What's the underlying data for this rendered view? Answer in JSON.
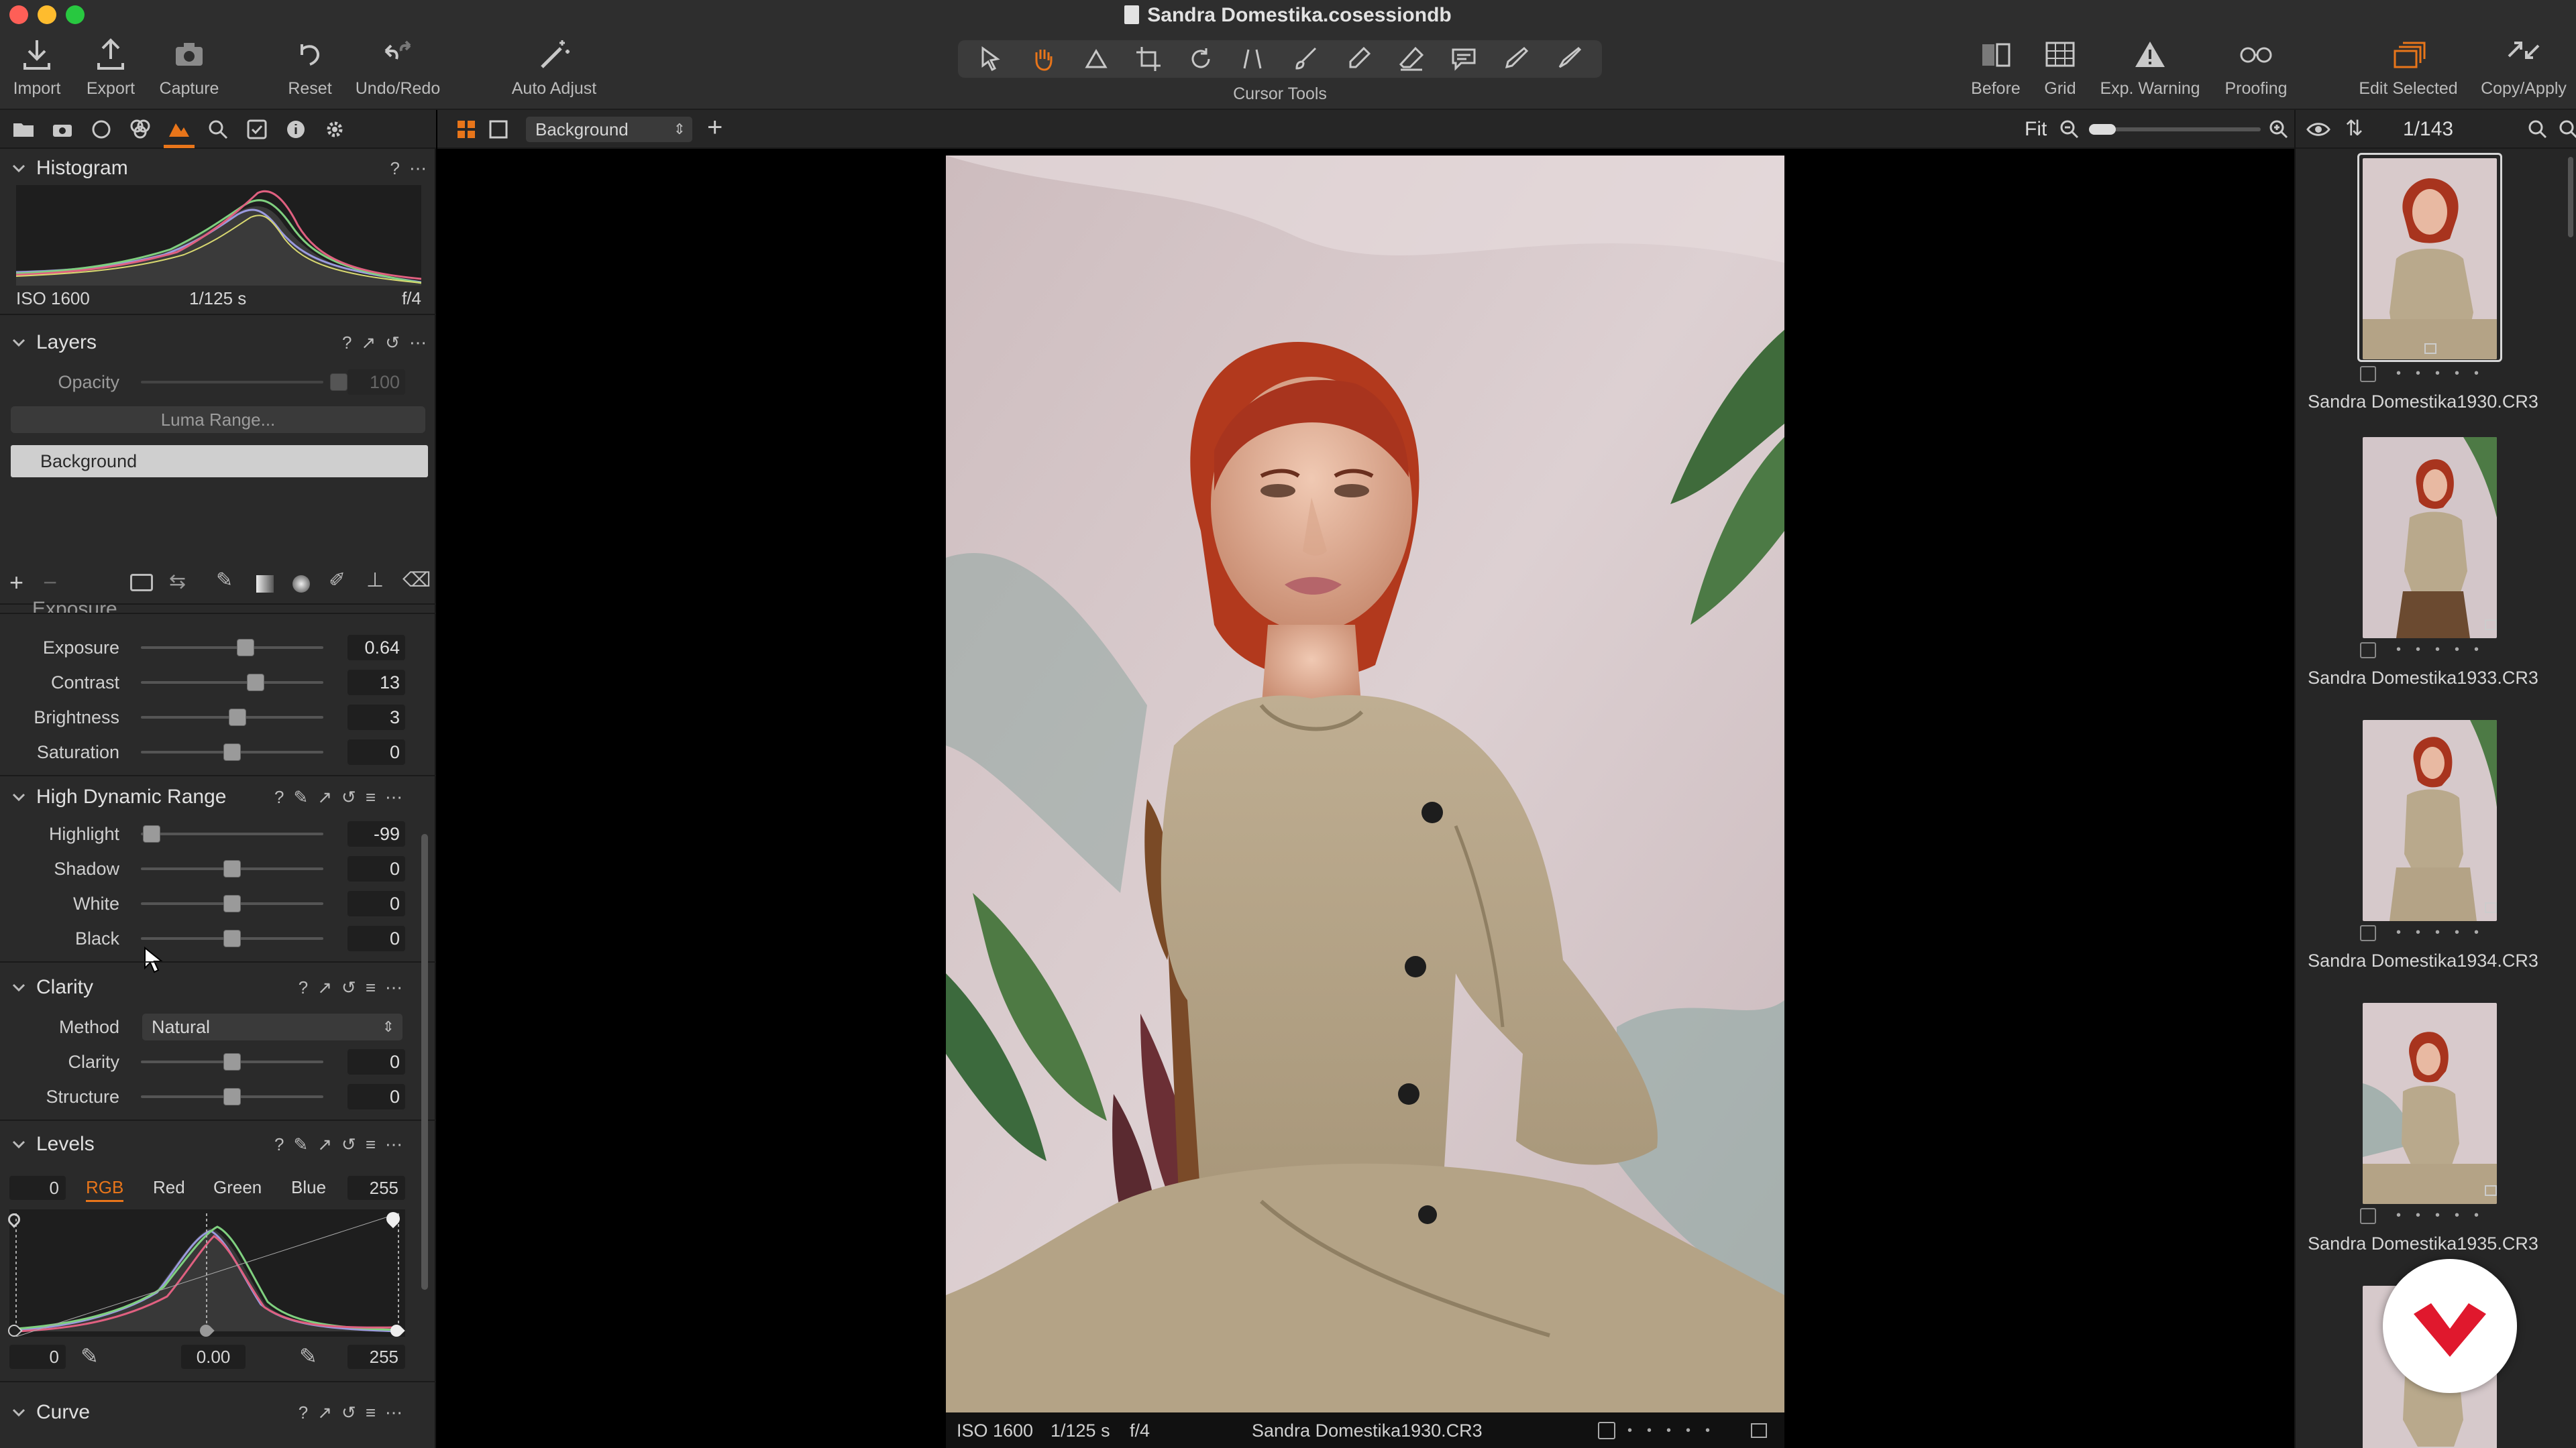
{
  "window": {
    "title": "Sandra Domestika.cosessiondb"
  },
  "toolbar": {
    "left": [
      {
        "label": "Import",
        "icon": "import-icon"
      },
      {
        "label": "Export",
        "icon": "export-icon"
      },
      {
        "label": "Capture",
        "icon": "camera-icon"
      },
      {
        "label": "Reset",
        "icon": "reset-icon"
      },
      {
        "label": "Undo/Redo",
        "icon": "undo-redo-icon"
      },
      {
        "label": "Auto Adjust",
        "icon": "magic-wand-icon"
      }
    ],
    "cursor_tools_label": "Cursor Tools",
    "right": [
      {
        "label": "Before",
        "icon": "before-after-icon"
      },
      {
        "label": "Grid",
        "icon": "grid-icon"
      },
      {
        "label": "Exp. Warning",
        "icon": "warning-icon"
      },
      {
        "label": "Proofing",
        "icon": "glasses-icon"
      },
      {
        "label": "Edit Selected",
        "icon": "edit-selected-icon"
      },
      {
        "label": "Copy/Apply",
        "icon": "copy-apply-icon"
      }
    ]
  },
  "histogram": {
    "title": "Histogram",
    "iso": "ISO 1600",
    "shutter": "1/125 s",
    "aperture": "f/4"
  },
  "layers": {
    "title": "Layers",
    "opacity_label": "Opacity",
    "opacity_value": "100",
    "luma_button": "Luma Range...",
    "items": [
      {
        "name": "Background"
      }
    ]
  },
  "exposure": {
    "title": "Exposure",
    "sliders": [
      {
        "label": "Exposure",
        "value": "0.64",
        "pos": 0.57
      },
      {
        "label": "Contrast",
        "value": "13",
        "pos": 0.63
      },
      {
        "label": "Brightness",
        "value": "3",
        "pos": 0.53
      },
      {
        "label": "Saturation",
        "value": "0",
        "pos": 0.5
      }
    ]
  },
  "hdr": {
    "title": "High Dynamic Range",
    "sliders": [
      {
        "label": "Highlight",
        "value": "-99",
        "pos": 0.05
      },
      {
        "label": "Shadow",
        "value": "0",
        "pos": 0.5
      },
      {
        "label": "White",
        "value": "0",
        "pos": 0.5
      },
      {
        "label": "Black",
        "value": "0",
        "pos": 0.5
      }
    ]
  },
  "clarity": {
    "title": "Clarity",
    "method_label": "Method",
    "method_value": "Natural",
    "sliders": [
      {
        "label": "Clarity",
        "value": "0",
        "pos": 0.5
      },
      {
        "label": "Structure",
        "value": "0",
        "pos": 0.5
      }
    ]
  },
  "levels": {
    "title": "Levels",
    "input_low": "0",
    "input_high": "255",
    "channels": [
      "RGB",
      "Red",
      "Green",
      "Blue"
    ],
    "active_channel": "RGB",
    "output_low": "0",
    "midpoint": "0.00",
    "output_high": "255"
  },
  "curve": {
    "title": "Curve"
  },
  "viewer": {
    "variant_name": "Background",
    "zoom_label": "Fit",
    "info_iso": "ISO 1600",
    "info_shutter": "1/125 s",
    "info_aperture": "f/4",
    "info_filename": "Sandra Domestika1930.CR3"
  },
  "browser": {
    "counter": "1/143",
    "items": [
      {
        "name": "Sandra Domestika1930.CR3",
        "selected": true
      },
      {
        "name": "Sandra Domestika1933.CR3",
        "selected": false
      },
      {
        "name": "Sandra Domestika1934.CR3",
        "selected": false
      },
      {
        "name": "Sandra Domestika1935.CR3",
        "selected": false
      }
    ]
  },
  "colors": {
    "accent": "#e8751a",
    "panel": "#2a2a2a",
    "toolbar": "#2e2e2e",
    "backdrop": "#d9c7c9",
    "outfit": "#b8a88d",
    "hair": "#a8341e"
  }
}
